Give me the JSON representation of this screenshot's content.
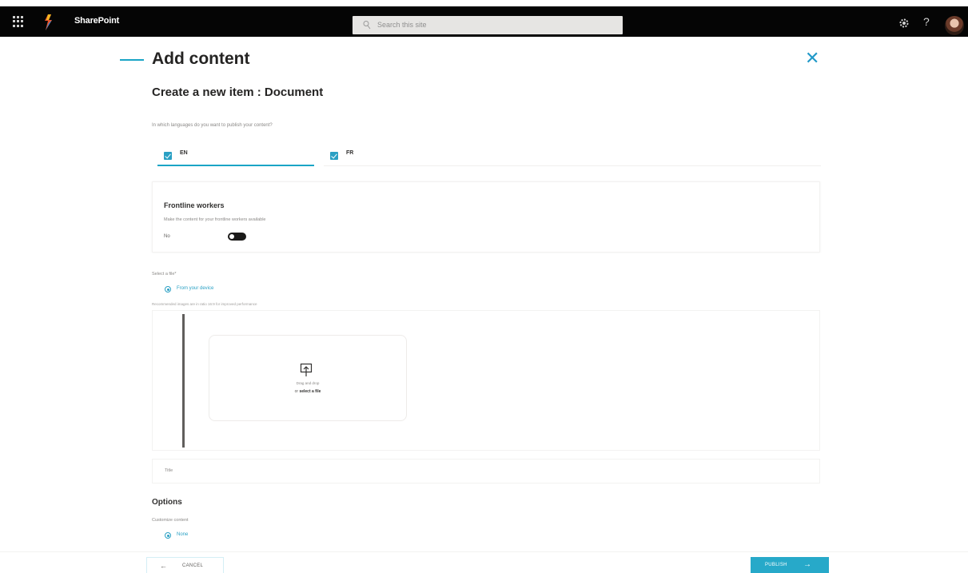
{
  "suite_bar": {
    "app_name": "SharePoint",
    "search_placeholder": "Search this site",
    "icons": [
      "waffle-icon",
      "app-logo-icon",
      "search-icon",
      "gear-icon",
      "help-icon",
      "avatar"
    ],
    "help_glyph": "?"
  },
  "panel": {
    "title": "Add content",
    "close_glyph": "✕",
    "subtitle": "Create a new item : Document",
    "language_question": "In which languages do you want to publish your content?",
    "languages": [
      {
        "label": "EN",
        "checked": true,
        "selected": true
      },
      {
        "label": "FR",
        "checked": true,
        "selected": false
      }
    ]
  },
  "frontline": {
    "title": "Frontline workers",
    "description": "Make the content for your frontline workers available",
    "state_label": "No",
    "enabled": false
  },
  "file": {
    "select_label": "Select a file*",
    "source_option": "From your device",
    "hint": "Recommended images are in ratio 16:9 for improved performance",
    "drop_line1": "Drag and drop",
    "drop_or": "or",
    "drop_link": "select a file"
  },
  "title_field": {
    "label": "Title"
  },
  "options": {
    "title": "Options",
    "customize_label": "Customize content",
    "none_option": "None"
  },
  "footer": {
    "cancel_label": "CANCEL",
    "cancel_arrow": "←",
    "publish_label": "PUBLISH",
    "publish_arrow": "→"
  },
  "colors": {
    "accent": "#1aa5c6",
    "publish_button": "#27a9c9",
    "suite_bar": "#050505"
  }
}
